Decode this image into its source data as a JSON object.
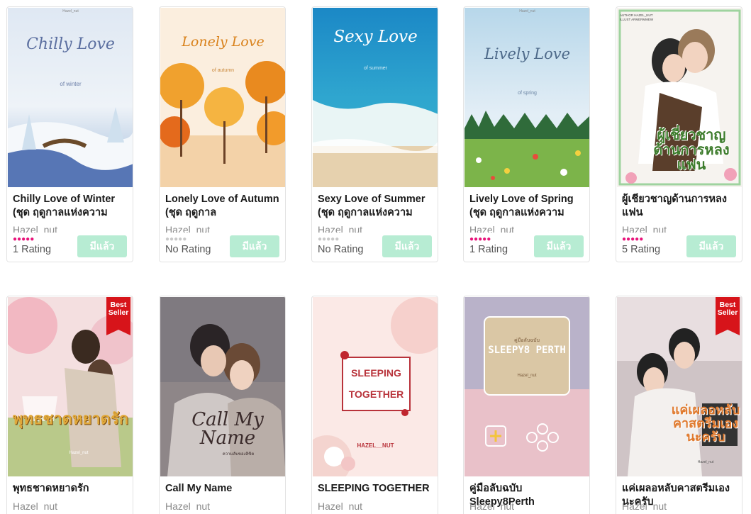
{
  "owned_label": "มีแล้ว",
  "badge_label": "Best Seller",
  "colors": {
    "star_on": "#e8137a",
    "star_off": "#c9c9c9",
    "owned_bg": "#b7ecd3",
    "badge_bg": "#d7141a"
  },
  "books": [
    {
      "title": "Chilly Love of Winter (ชุด ฤดูกาลแห่งความ",
      "author": "Hazel_nut",
      "rating_stars": 5,
      "rating_text": "1 Rating",
      "cover": {
        "title": "Chilly Love",
        "subtitle": "of winter",
        "publisher": "Hazel_nut"
      }
    },
    {
      "title": "Lonely Love of Autumn (ชุด ฤดูกาล",
      "author": "Hazel_nut",
      "rating_stars": 0,
      "rating_text": "No Rating",
      "cover": {
        "title": "Lonely Love",
        "subtitle": "of autumn"
      }
    },
    {
      "title": "Sexy Love of Summer (ชุด ฤดูกาลแห่งความ",
      "author": "Hazel_nut",
      "rating_stars": 0,
      "rating_text": "No Rating",
      "cover": {
        "title": "Sexy Love",
        "subtitle": "of summer"
      }
    },
    {
      "title": "Lively Love of Spring (ชุด ฤดูกาลแห่งความ",
      "author": "Hazel_nut",
      "rating_stars": 5,
      "rating_text": "1 Rating",
      "cover": {
        "title": "Lively Love",
        "subtitle": "of spring",
        "publisher": "Hazel_nut"
      }
    },
    {
      "title": "ผู้เชี่ยวชาญด้านการหลงแฟน",
      "author": "Hazel_nut",
      "rating_stars": 5,
      "rating_text": "5 Rating",
      "cover": {
        "title": "ผู้เชี่ยวชาญด้านการหลงแฟน",
        "credit": "AUTHOR HAZEL_NUT ILLUST ARMERMMEW"
      }
    },
    {
      "title": "พุทธชาดหยาดรัก",
      "author": "Hazel_nut",
      "best_seller": true,
      "cover": {
        "title": "พุทธชาดหยาดรัก",
        "subtitle": "Hazel_nut"
      }
    },
    {
      "title": "Call My Name",
      "author": "Hazel_nut",
      "cover": {
        "title": "Call My Name",
        "subtitle": "ความลับของลิขิต"
      }
    },
    {
      "title": "SLEEPING TOGETHER",
      "author": "Hazel_nut",
      "cover": {
        "title": "SLEEPING TOGETHER",
        "publisher": "HAZEL__NUT"
      }
    },
    {
      "title": "คู่มือลับฉบับ Sleepy8Perth",
      "author": "Hazel_nut",
      "cover": {
        "title": "SLEEPY8 PERTH",
        "subtitle": "คู่มือลับฉบับ",
        "publisher": "Hazel_nut"
      }
    },
    {
      "title": "แค่เผลอหลับคาสตรีมเองนะครับ",
      "author": "Hazel_nut",
      "best_seller": true,
      "cover": {
        "title": "แค่เผลอหลับคาสตรีมเองนะครับ",
        "credit": "Hazel_nut"
      }
    }
  ]
}
